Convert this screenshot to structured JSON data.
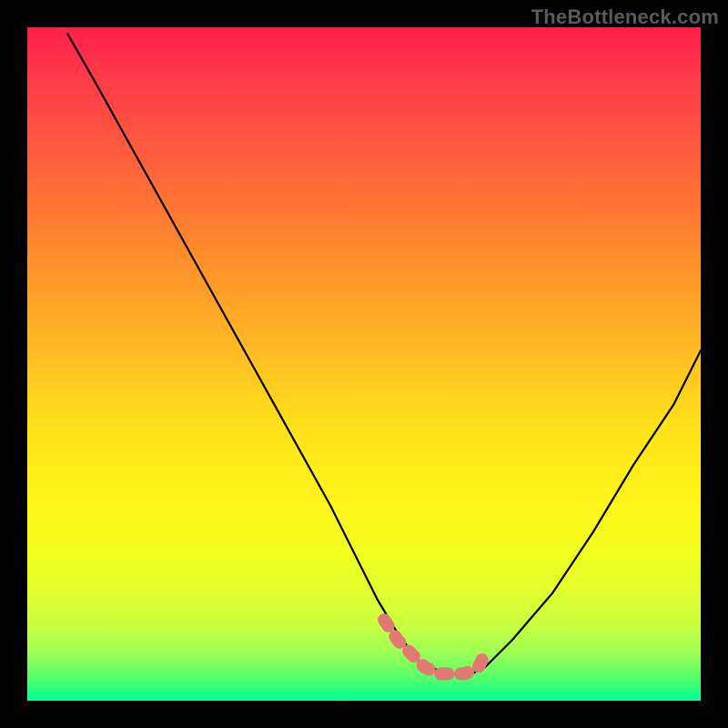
{
  "watermark": "TheBottleneck.com",
  "chart_data": {
    "type": "line",
    "title": "",
    "xlabel": "",
    "ylabel": "",
    "xlim": [
      0,
      100
    ],
    "ylim": [
      0,
      100
    ],
    "grid": false,
    "legend": false,
    "series": [
      {
        "name": "bottleneck-curve",
        "color": "#000000",
        "x": [
          6,
          10,
          15,
          20,
          25,
          30,
          35,
          40,
          45,
          50,
          52,
          55,
          58,
          62,
          66,
          68,
          72,
          78,
          84,
          90,
          96,
          100
        ],
        "values": [
          99,
          92,
          83,
          74,
          65,
          56,
          47,
          38,
          29,
          19,
          15,
          10,
          6,
          4,
          4,
          5,
          9,
          16,
          25,
          35,
          44,
          52
        ]
      }
    ],
    "highlight": {
      "name": "minimum-plateau",
      "color": "#e27a74",
      "x": [
        53,
        55,
        57,
        59,
        61,
        63,
        65,
        67,
        68
      ],
      "values": [
        12,
        9,
        7,
        5,
        4,
        4,
        4,
        5,
        7
      ]
    },
    "background_gradient": {
      "top": "#ff1f4a",
      "mid": "#ffe31a",
      "bottom": "#00ff9e"
    }
  }
}
